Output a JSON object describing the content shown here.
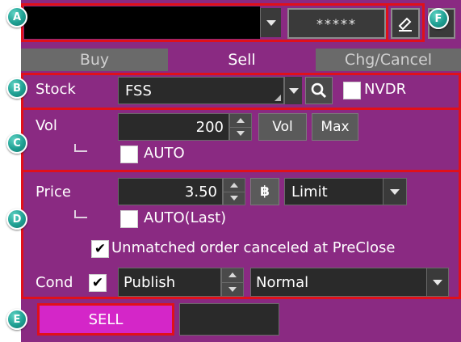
{
  "callouts": {
    "a": "A",
    "b": "B",
    "c": "C",
    "d": "D",
    "e": "E",
    "f": "F"
  },
  "account": {
    "value": "",
    "password_mask": "*****"
  },
  "tabs": [
    {
      "label": "Buy"
    },
    {
      "label": "Sell"
    },
    {
      "label": "Chg/Cancel"
    }
  ],
  "stock": {
    "label": "Stock",
    "value": "FSS",
    "nvdr_label": "NVDR",
    "nvdr_checked": false
  },
  "volume": {
    "label": "Vol",
    "value": "200",
    "vol_button": "Vol",
    "max_button": "Max",
    "auto_label": "AUTO",
    "auto_checked": false
  },
  "price": {
    "label": "Price",
    "value": "3.50",
    "baht_symbol": "฿",
    "order_type": "Limit",
    "auto_last_label": "AUTO(Last)",
    "auto_last_checked": false
  },
  "preclose": {
    "label": "Unmatched order canceled at PreClose",
    "checked": true
  },
  "condition": {
    "label": "Cond",
    "checked": true,
    "publish_value": "Publish",
    "validity_value": "Normal"
  },
  "submit": {
    "label": "SELL"
  },
  "colors": {
    "panel": "#8a2a82",
    "sell_button": "#d426c8",
    "active_tab": "#8a2a82",
    "tab_inactive": "#6a6a6a",
    "outline": "#e0101a"
  }
}
